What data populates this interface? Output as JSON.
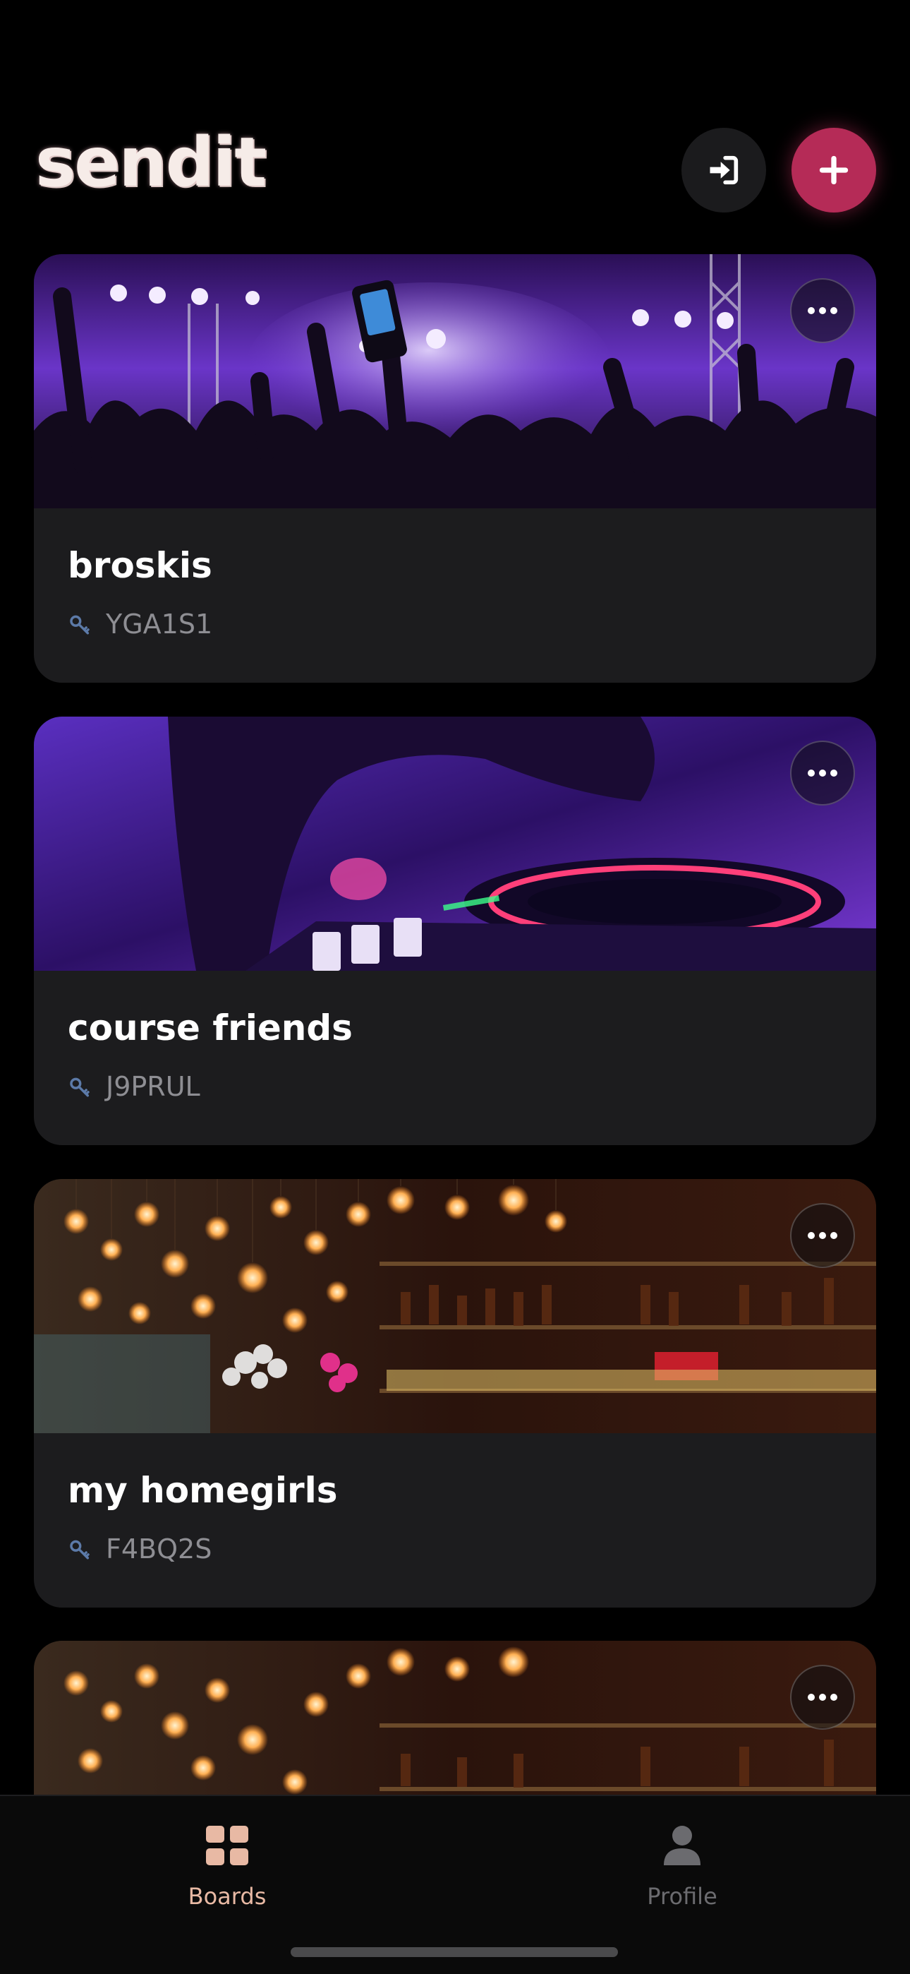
{
  "app": {
    "logo": "sendit"
  },
  "header": {
    "login_icon": "sign-in-icon",
    "add_icon": "plus-icon",
    "accent": "#b52b57"
  },
  "boards": [
    {
      "title": "broskis",
      "code": "YGA1S1",
      "image": "concert crowd with purple stage lights"
    },
    {
      "title": "course friends",
      "code": "J9PRUL",
      "image": "dj hand on turntable in purple light"
    },
    {
      "title": "my homegirls",
      "code": "F4BQ2S",
      "image": "bar with hanging edison bulbs"
    },
    {
      "title": "",
      "code": "",
      "image": "bar with hanging edison bulbs"
    }
  ],
  "tabbar": {
    "boards_label": "Boards",
    "profile_label": "Profile",
    "active_color": "#e8b9a4",
    "inactive_color": "#6b6b6f"
  }
}
